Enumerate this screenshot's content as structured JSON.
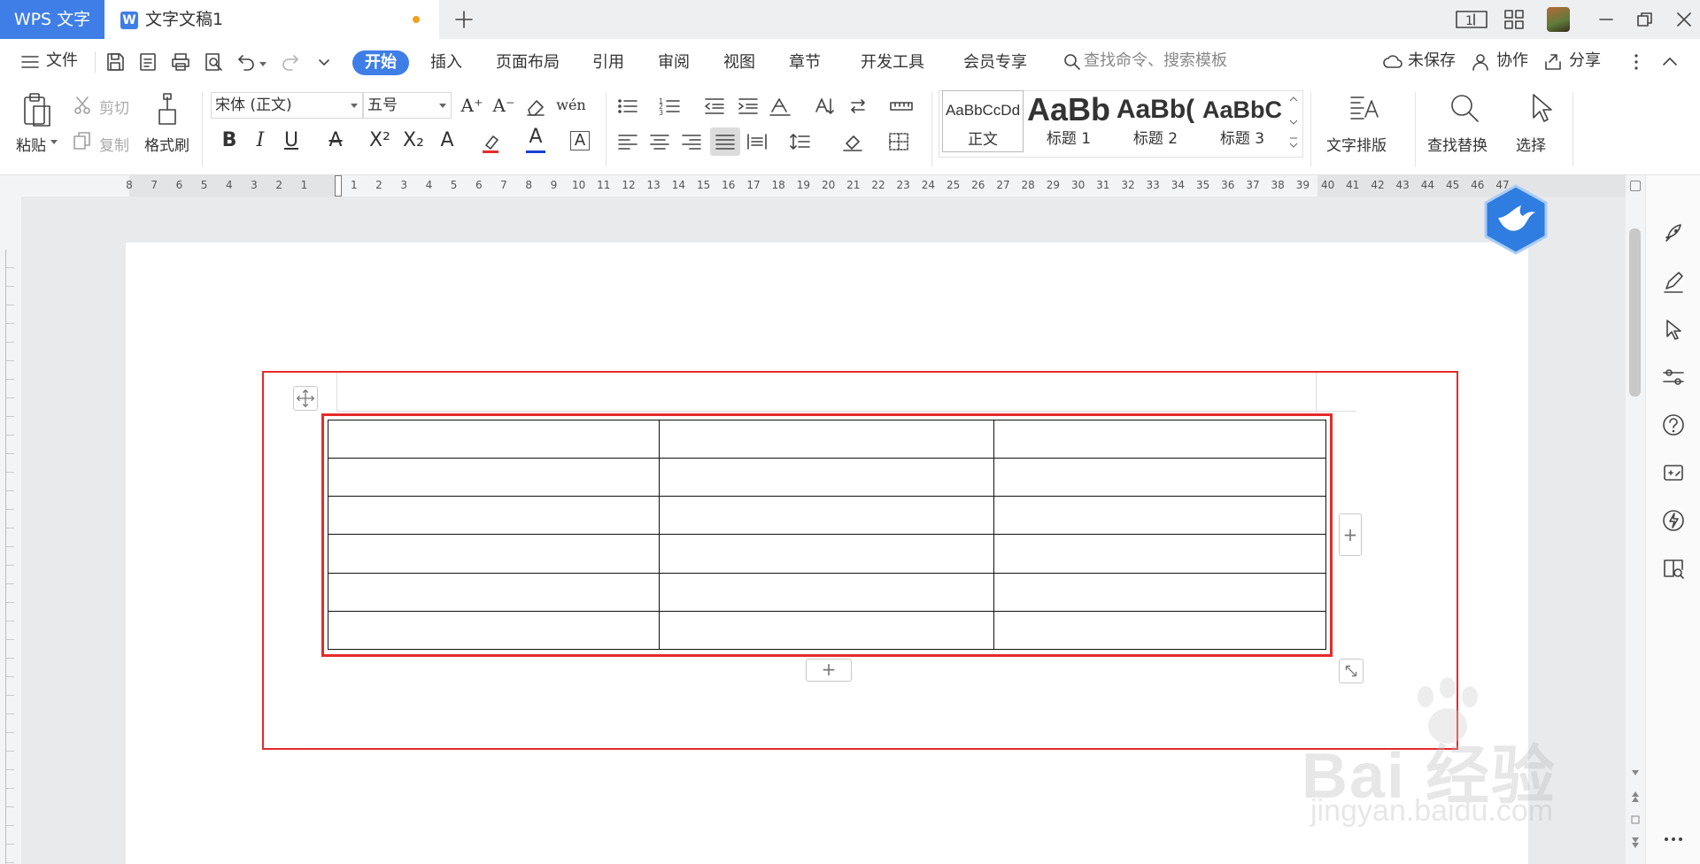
{
  "titlebar": {
    "app_tab": "WPS 文字",
    "doc_title": "文字文稿1",
    "new_tab_icon": "plus-icon"
  },
  "menubar": {
    "file_label": "文件",
    "tabs": [
      "开始",
      "插入",
      "页面布局",
      "引用",
      "审阅",
      "视图",
      "章节",
      "开发工具",
      "会员专享"
    ],
    "search_placeholder": "查找命令、搜索模板",
    "unsaved_label": "未保存",
    "collab_label": "协作",
    "share_label": "分享"
  },
  "ribbon": {
    "paste_label": "粘贴",
    "cut_label": "剪切",
    "copy_label": "复制",
    "format_painter_label": "格式刷",
    "font_name": "宋体 (正文)",
    "font_size": "五号",
    "styles": [
      {
        "preview": "AaBbCcDd",
        "name": "正文"
      },
      {
        "preview": "AaBb",
        "name": "标题 1"
      },
      {
        "preview": "AaBb(",
        "name": "标题 2"
      },
      {
        "preview": "AaBbC",
        "name": "标题 3"
      }
    ],
    "text_layout_label": "文字排版",
    "find_replace_label": "查找替换",
    "select_label": "选择"
  },
  "ruler": {
    "numbers": [
      "8",
      "7",
      "6",
      "5",
      "4",
      "3",
      "2",
      "1",
      "",
      "1",
      "2",
      "3",
      "4",
      "5",
      "6",
      "7",
      "8",
      "9",
      "10",
      "11",
      "12",
      "13",
      "14",
      "15",
      "16",
      "17",
      "18",
      "19",
      "20",
      "21",
      "22",
      "23",
      "24",
      "25",
      "26",
      "27",
      "28",
      "29",
      "30",
      "31",
      "32",
      "33",
      "34",
      "35",
      "36",
      "37",
      "38",
      "39",
      "40",
      "41",
      "42",
      "43",
      "44",
      "45",
      "46",
      "47"
    ]
  },
  "document": {
    "table": {
      "rows": 6,
      "cols": 3
    },
    "add_row_icon": "plus-icon",
    "add_col_icon": "plus-icon"
  },
  "watermark": {
    "main": "Bai 经验",
    "sub": "jingyan.baidu.com"
  },
  "colors": {
    "accent": "#3f7ee6",
    "highlight_box": "#e52b2b"
  }
}
